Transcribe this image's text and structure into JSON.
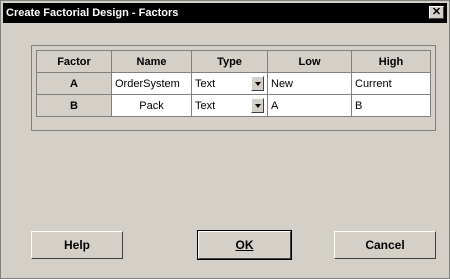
{
  "window": {
    "title": "Create Factorial Design - Factors",
    "close_glyph": "✕"
  },
  "grid": {
    "headers": [
      "Factor",
      "Name",
      "Type",
      "Low",
      "High"
    ],
    "rows": [
      {
        "factor": "A",
        "name": "OrderSystem",
        "type": "Text",
        "low": "New",
        "high": "Current"
      },
      {
        "factor": "B",
        "name": "Pack",
        "type": "Text",
        "low": "A",
        "high": "B"
      }
    ]
  },
  "buttons": {
    "help": "Help",
    "ok": "OK",
    "cancel": "Cancel"
  }
}
